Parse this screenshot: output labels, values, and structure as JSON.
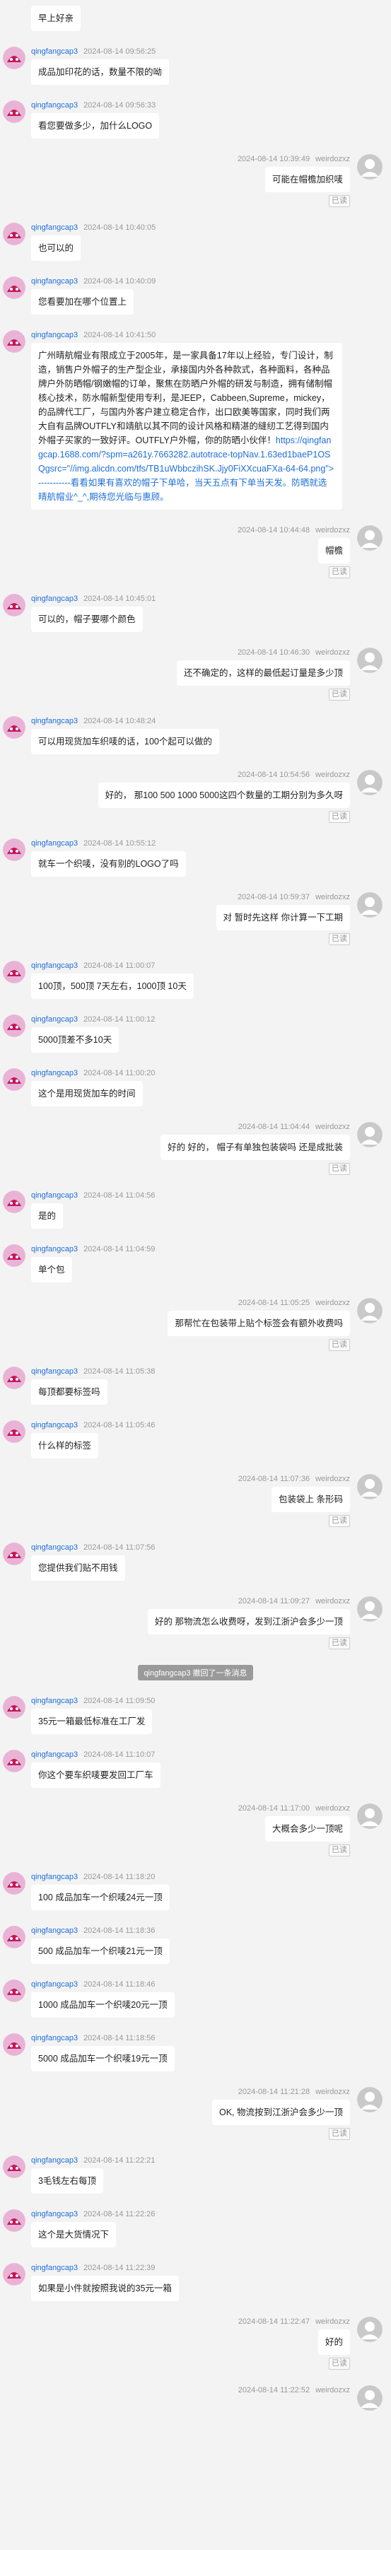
{
  "colors": {
    "link": "#1e6fd9",
    "background": "#f3f3f3",
    "bubble": "#ffffff"
  },
  "self_nick": "weirdozxz",
  "read_label": "已读",
  "messages": [
    {
      "side": "l",
      "nick": "",
      "time": "",
      "text": "早上好亲"
    },
    {
      "side": "l",
      "nick": "qingfangcap3",
      "time": "2024-08-14 09:56:25",
      "text": "成品加印花的话，数量不限的呦"
    },
    {
      "side": "l",
      "nick": "qingfangcap3",
      "time": "2024-08-14 09:56:33",
      "text": "看您要做多少，加什么LOGO"
    },
    {
      "side": "r",
      "time": "2024-08-14 10:39:49",
      "text": "可能在帽檐加织唛"
    },
    {
      "side": "l",
      "nick": "qingfangcap3",
      "time": "2024-08-14 10:40:05",
      "text": "也可以的"
    },
    {
      "side": "l",
      "nick": "qingfangcap3",
      "time": "2024-08-14 10:40:09",
      "text": "您看要加在哪个位置上"
    },
    {
      "side": "l",
      "nick": "qingfangcap3",
      "time": "2024-08-14 10:41:50",
      "text": "广州晴航帽业有限成立于2005年，是一家具备17年以上经验，专门设计，制造，销售户外帽子的生产型企业，承接国内外各种款式，各种面料，各种品牌户外防晒帽/钢嫩帽的订单，聚焦在防晒户外帽的研发与制造，拥有储制帽核心技术，防水帽新型使用专利，是JEEP，Cabbeen,Supreme，mickey，的品牌代工厂，与国内外客户建立稳定合作，出口欧美等国家，同时我们两大自有品牌OUTFLY和靖航以其不同的设计风格和精湛的缝纫工艺得到国内外帽子买家的一致好评。OUTFLY户外帽，你的防晒小伙伴！",
      "link": "https://qingfangcap.1688.com/?spm=a261y.7663282.autotrace-topNav.1.63ed1baeP1OSQgsrc=\"//img.alicdn.com/tfs/TB1uWbbczihSK.Jjy0FiXXcuaFXa-64-64.png\">-----------看看如果有喜欢的帽子下单哈，当天五点有下单当天发。防晒就选晴航帽业^_^,期待您光临与惠顾。"
    },
    {
      "side": "r",
      "time": "2024-08-14 10:44:48",
      "text": "帽檐"
    },
    {
      "side": "l",
      "nick": "qingfangcap3",
      "time": "2024-08-14 10:45:01",
      "text": "可以的，帽子要哪个颜色"
    },
    {
      "side": "r",
      "time": "2024-08-14 10:46:30",
      "text": "还不确定的，这样的最低起订量是多少顶"
    },
    {
      "side": "l",
      "nick": "qingfangcap3",
      "time": "2024-08-14 10:48:24",
      "text": "可以用现货加车织唛的话，100个起可以做的"
    },
    {
      "side": "r",
      "time": "2024-08-14 10:54:56",
      "text": "好的， 那100 500 1000 5000这四个数量的工期分别为多久呀"
    },
    {
      "side": "l",
      "nick": "qingfangcap3",
      "time": "2024-08-14 10:55:12",
      "text": "就车一个织唛，没有别的LOGO了吗"
    },
    {
      "side": "r",
      "time": "2024-08-14 10:59:37",
      "text": "对 暂时先这样 你计算一下工期"
    },
    {
      "side": "l",
      "nick": "qingfangcap3",
      "time": "2024-08-14 11:00:07",
      "text": "100顶，500顶 7天左右，1000顶 10天"
    },
    {
      "side": "l",
      "nick": "qingfangcap3",
      "time": "2024-08-14 11:00:12",
      "text": "5000顶差不多10天"
    },
    {
      "side": "l",
      "nick": "qingfangcap3",
      "time": "2024-08-14 11:00:20",
      "text": "这个是用现货加车的时间"
    },
    {
      "side": "r",
      "time": "2024-08-14 11:04:44",
      "text": "好的 好的， 帽子有单独包装袋吗 还是成批装"
    },
    {
      "side": "l",
      "nick": "qingfangcap3",
      "time": "2024-08-14 11:04:56",
      "text": "是的"
    },
    {
      "side": "l",
      "nick": "qingfangcap3",
      "time": "2024-08-14 11:04:59",
      "text": "单个包"
    },
    {
      "side": "r",
      "time": "2024-08-14 11:05:25",
      "text": "那帮忙在包装带上贴个标签会有额外收费吗"
    },
    {
      "side": "l",
      "nick": "qingfangcap3",
      "time": "2024-08-14 11:05:38",
      "text": "每顶都要标签吗"
    },
    {
      "side": "l",
      "nick": "qingfangcap3",
      "time": "2024-08-14 11:05:46",
      "text": "什么样的标签"
    },
    {
      "side": "r",
      "time": "2024-08-14 11:07:36",
      "text": "包装袋上 条形码"
    },
    {
      "side": "l",
      "nick": "qingfangcap3",
      "time": "2024-08-14 11:07:56",
      "text": "您提供我们贴不用钱"
    },
    {
      "side": "r",
      "time": "2024-08-14 11:09:27",
      "text": "好的 那物流怎么收费呀，发到江浙沪会多少一顶"
    },
    {
      "side": "sys",
      "text": "qingfangcap3 撤回了一条消息"
    },
    {
      "side": "l",
      "nick": "qingfangcap3",
      "time": "2024-08-14 11:09:50",
      "text": "35元一箱最低标准在工厂发"
    },
    {
      "side": "l",
      "nick": "qingfangcap3",
      "time": "2024-08-14 11:10:07",
      "text": "你这个要车织唛要发回工厂车"
    },
    {
      "side": "r",
      "time": "2024-08-14 11:17:00",
      "text": "大概会多少一顶呢"
    },
    {
      "side": "l",
      "nick": "qingfangcap3",
      "time": "2024-08-14 11:18:20",
      "text": "100  成品加车一个织唛24元一顶"
    },
    {
      "side": "l",
      "nick": "qingfangcap3",
      "time": "2024-08-14 11:18:36",
      "text": "500  成品加车一个织唛21元一顶"
    },
    {
      "side": "l",
      "nick": "qingfangcap3",
      "time": "2024-08-14 11:18:46",
      "text": "1000  成品加车一个织唛20元一顶"
    },
    {
      "side": "l",
      "nick": "qingfangcap3",
      "time": "2024-08-14 11:18:56",
      "text": "5000  成品加车一个织唛19元一顶"
    },
    {
      "side": "r",
      "time": "2024-08-14 11:21:28",
      "text": "OK,   物流按到江浙沪会多少一顶"
    },
    {
      "side": "l",
      "nick": "qingfangcap3",
      "time": "2024-08-14 11:22:21",
      "text": "3毛钱左右每顶"
    },
    {
      "side": "l",
      "nick": "qingfangcap3",
      "time": "2024-08-14 11:22:26",
      "text": "这个是大货情况下"
    },
    {
      "side": "l",
      "nick": "qingfangcap3",
      "time": "2024-08-14 11:22:39",
      "text": "如果是小件就按照我说的35元一箱"
    },
    {
      "side": "r",
      "time": "2024-08-14 11:22:47",
      "text": "好的"
    },
    {
      "side": "r",
      "time": "2024-08-14 11:22:52",
      "text": ""
    }
  ]
}
